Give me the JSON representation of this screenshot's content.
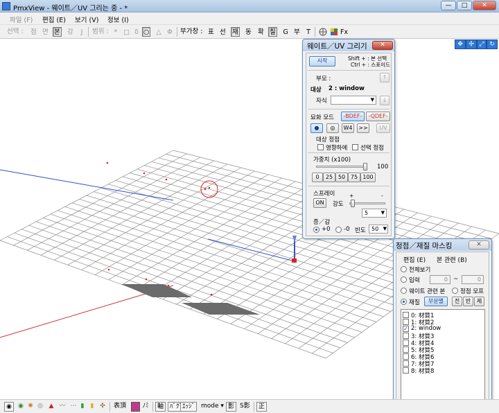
{
  "window": {
    "title": "PmxView - 웨이트／UV 그리는 중 - *",
    "caption_buttons": [
      "—",
      "□",
      "✕"
    ]
  },
  "menu": [
    "파일 (F)",
    "편집 (E)",
    "보기 (V)",
    "정보 (I)"
  ],
  "toolbar": {
    "select_label": "선택 :",
    "select_items": [
      "점",
      "면",
      "본",
      "강",
      "J"
    ],
    "range_label": "범위 :",
    "range_items": [
      "*",
      "□",
      "δ",
      "○",
      "△",
      "Φ"
    ],
    "extra_label": "부가창 :",
    "extra_items": [
      "표",
      "선",
      "재",
      "동",
      "확",
      "칠",
      "G",
      "부",
      "T"
    ],
    "fx_label": "Fx"
  },
  "weight_panel": {
    "title": "웨이트／UV 그리기",
    "close": "✕",
    "start_button": "시작",
    "hint_line1": "Shift + : 본 선택",
    "hint_line2": "Ctrl + : 스포이드",
    "parent_label": "부모 :",
    "up_arrow": "↑",
    "target_label": "대상",
    "target_value": "2 : window",
    "child_label": "자식",
    "down_arrow": "↓",
    "draw_mode_label": "묘화 모드",
    "bdef_button": "-BDEF-",
    "qdef_button": "-QDEF-",
    "mode_buttons": [
      "●",
      "◎",
      "W4",
      ">>",
      "UV"
    ],
    "target_vertex_label": "대상 정점",
    "influence_check": "영향하에",
    "selected_vertex_check": "선택 정점",
    "add_value_label": "가중치 (x100)",
    "add_value": "100",
    "preset_buttons": [
      "0",
      "25",
      "50",
      "75",
      "100"
    ],
    "spray_label": "스프레이",
    "spray_toggle": "ON",
    "strength_label": "강도",
    "strength_minus": "-",
    "strength_plus": "+",
    "strength_value": "5",
    "increase_label": "증／감",
    "radio_plus": "+0",
    "radio_minus": "-0",
    "frequency_label": "빈도",
    "frequency_value": "50"
  },
  "masking_panel": {
    "title": "정점／재질 마스킹",
    "close": "✕",
    "menu": [
      "편집 (E)",
      "본 관련 (B)"
    ],
    "all_view": "전체보기",
    "input_label": "입력",
    "input_from": "0",
    "input_tilde": "~",
    "input_to": "0",
    "weight_bone": "웨이트 관련 본",
    "vertex_morph": "정점 모프",
    "material_label": "재질",
    "by_part_button": "부분별",
    "scope_buttons": [
      "전",
      "반",
      "제"
    ],
    "materials": [
      {
        "label": "0: 材質1",
        "checked": false
      },
      {
        "label": "1: 材質2",
        "checked": false
      },
      {
        "label": "2: window",
        "checked": true
      },
      {
        "label": "3: 材質3",
        "checked": false
      },
      {
        "label": "4: 材質4",
        "checked": false
      },
      {
        "label": "5: 材質5",
        "checked": false
      },
      {
        "label": "6: 材質6",
        "checked": false
      },
      {
        "label": "7: 材質7",
        "checked": false
      },
      {
        "label": "8: 材質8",
        "checked": false
      }
    ]
  },
  "statusbar": {
    "face_label": "表頂",
    "axis_button": "軸",
    "nb_button": "ﾊﾞｸﾞ",
    "edge_button": "ｴｯｼﾞ",
    "mode_label": "mode",
    "shadow_button": "影",
    "sshadow_label": "S影",
    "front_button": "正"
  },
  "colors": {
    "accent": "#4f7fb8",
    "title_bar": "#bcd1ea",
    "grid": "#8c8c8c",
    "axis_x": "#d03030",
    "axis_z": "#3050c8",
    "material": "#6b6b6b",
    "selection": "#e02020"
  }
}
